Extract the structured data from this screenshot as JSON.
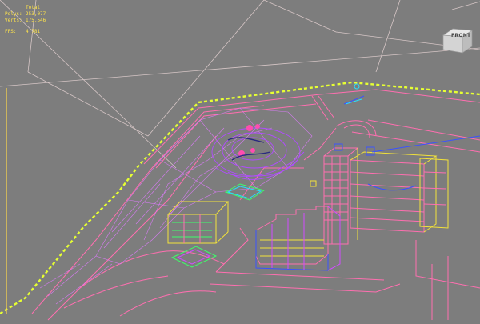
{
  "stats": {
    "header": "Total",
    "polys_label": "Polys:",
    "polys_value": "253,077",
    "verts_label": "Verts:",
    "verts_value": "175,546",
    "fps_label": "FPS:",
    "fps_value": "4.781"
  },
  "viewcube": {
    "face_label": "FRONT"
  },
  "colors": {
    "viewport_bg": "#7d7d7d",
    "stats_text": "#ffe44a",
    "boundary_dashed": "#e6ff33",
    "wire_pink": "#ff6fb0",
    "wire_magenta": "#d14cff",
    "wire_yellow": "#f2e23a",
    "wire_blue": "#3b52ff",
    "wire_cyan": "#28e0ff",
    "wire_green": "#3dff6a",
    "guide_line": "#d8c8c8"
  }
}
